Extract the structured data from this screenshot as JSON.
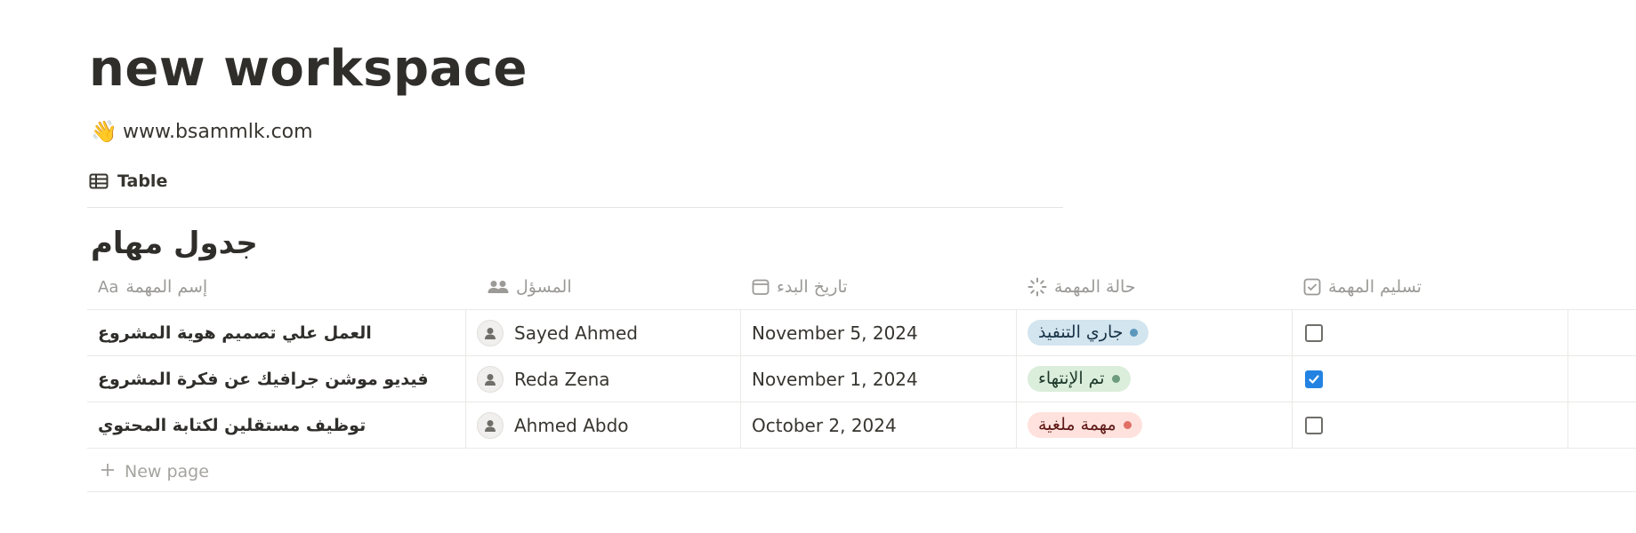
{
  "page": {
    "title": "new workspace",
    "subtitle_emoji": "👋",
    "subtitle": "www.bsammlk.com"
  },
  "views": {
    "active_tab": {
      "icon": "table-icon",
      "label": "Table"
    }
  },
  "database": {
    "title": "جدول مهام",
    "columns": [
      {
        "icon": "text-aa-icon",
        "icon_text": "Aa",
        "label": "إسم المهمة"
      },
      {
        "icon": "people-icon",
        "label": "المسؤل"
      },
      {
        "icon": "calendar-icon",
        "label": "تاريخ البدء"
      },
      {
        "icon": "status-loader-icon",
        "label": "حالة المهمة"
      },
      {
        "icon": "checkbox-icon",
        "label": "تسليم المهمة"
      }
    ],
    "rows": [
      {
        "name": "العمل علي تصميم هوية المشروع",
        "owner": "Sayed Ahmed",
        "start_date": "November 5, 2024",
        "status": "جاري التنفيذ",
        "status_color": "blue",
        "delivered": false
      },
      {
        "name": "فيديو موشن جرافيك عن فكرة المشروع",
        "owner": "Reda Zena",
        "start_date": "November 1, 2024",
        "status": "تم الإنتهاء",
        "status_color": "green",
        "delivered": true
      },
      {
        "name": "توظيف مستقلين لكتابة المحتوي",
        "owner": "Ahmed Abdo",
        "start_date": "October 2, 2024",
        "status": "مهمة ملغية",
        "status_color": "red",
        "delivered": false
      }
    ],
    "new_page_label": "New page"
  },
  "colors": {
    "blue": {
      "bg": "#d3e5ef",
      "dot": "#5b97bd",
      "text": "#183347"
    },
    "green": {
      "bg": "#dbeddb",
      "dot": "#6c9b7d",
      "text": "#1c3829"
    },
    "red": {
      "bg": "#ffe2dd",
      "dot": "#e16f64",
      "text": "#5d1715"
    },
    "accent": "#2383e2"
  }
}
